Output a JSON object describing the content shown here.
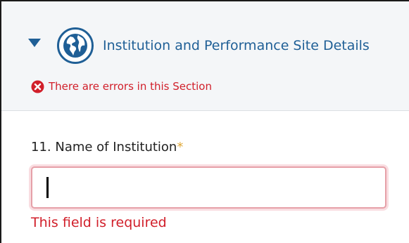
{
  "section": {
    "title": "Institution and Performance Site Details",
    "icon": "globe-icon",
    "toggle_icon": "caret-down-icon",
    "error_message": "There are errors in this Section",
    "error_icon": "error-circle-x-icon",
    "title_color": "#1f5f96",
    "error_color": "#d11f2a"
  },
  "form": {
    "name_of_institution": {
      "label": "11. Name of Institution",
      "required_marker": "*",
      "value": "",
      "validation_error": "This field is required"
    }
  }
}
